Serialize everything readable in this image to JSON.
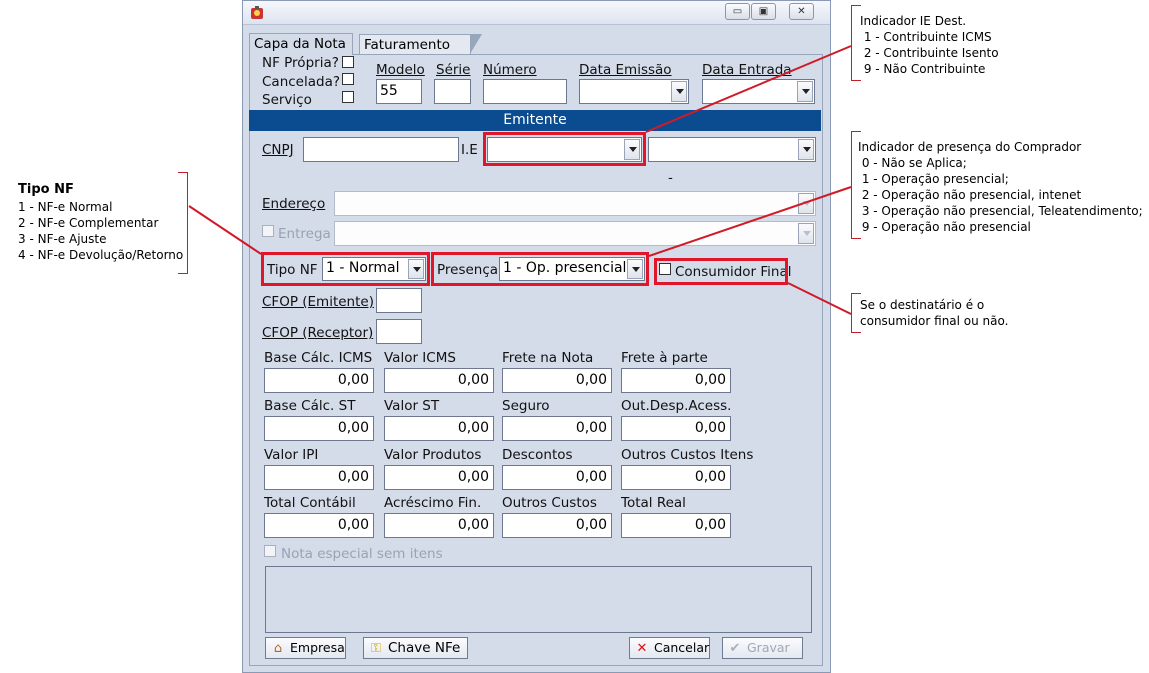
{
  "tabs": {
    "capa": "Capa da Nota",
    "faturamento": "Faturamento"
  },
  "window_controls": {
    "minimize": "▭",
    "restore": "▣",
    "close": "✕"
  },
  "flags": {
    "nf_propria": "NF Própria?",
    "cancelada": "Cancelada?",
    "servico": "Serviço"
  },
  "header_fields": {
    "modelo_label": "Modelo",
    "modelo_value": "55",
    "serie_label": "Série",
    "serie_value": "",
    "numero_label": "Número",
    "numero_value": "",
    "data_emissao_label": "Data Emissão",
    "data_emissao_value": "",
    "data_entrada_label": "Data Entrada",
    "data_entrada_value": ""
  },
  "emitente": {
    "section_title": "Emitente",
    "cnpj_label": "CNPJ",
    "cnpj_value": "",
    "ie_label": "I.E",
    "ie_value": "",
    "ie_extra_value": "",
    "dash": "-",
    "endereco_label": "Endereço",
    "endereco_value": "",
    "entrega_label": "Entrega",
    "entrega_value": ""
  },
  "selectors": {
    "tipo_nf_label": "Tipo NF",
    "tipo_nf_value": "1 - Normal",
    "presenca_label": "Presença",
    "presenca_value": "1 - Op. presencial;",
    "consumidor_final_label": "Consumidor Final"
  },
  "cfop": {
    "emitente_label": "CFOP (Emitente)",
    "receptor_label": "CFOP (Receptor)",
    "emitente_value": "",
    "receptor_value": ""
  },
  "totals": [
    {
      "label": "Base Cálc. ICMS",
      "value": "0,00"
    },
    {
      "label": "Valor ICMS",
      "value": "0,00"
    },
    {
      "label": "Frete na Nota",
      "value": "0,00"
    },
    {
      "label": "Frete à parte",
      "value": "0,00"
    },
    {
      "label": "Base Cálc. ST",
      "value": "0,00"
    },
    {
      "label": "Valor ST",
      "value": "0,00"
    },
    {
      "label": "Seguro",
      "value": "0,00"
    },
    {
      "label": "Out.Desp.Acess.",
      "value": "0,00"
    },
    {
      "label": "Valor IPI",
      "value": "0,00"
    },
    {
      "label": "Valor Produtos",
      "value": "0,00"
    },
    {
      "label": "Descontos",
      "value": "0,00"
    },
    {
      "label": "Outros Custos Itens",
      "value": "0,00"
    },
    {
      "label": "Total Contábil",
      "value": "0,00"
    },
    {
      "label": "Acréscimo Fin.",
      "value": "0,00"
    },
    {
      "label": "Outros Custos",
      "value": "0,00"
    },
    {
      "label": "Total Real",
      "value": "0,00"
    }
  ],
  "nota_especial_label": "Nota especial sem itens",
  "buttons": {
    "empresa": "Empresa",
    "chave_nfe": "Chave NFe",
    "cancelar": "Cancelar",
    "gravar": "Gravar"
  },
  "annotations": {
    "ie_dest": [
      "Indicador IE Dest.",
      " 1 - Contribuinte ICMS",
      " 2 - Contribuinte Isento",
      " 9 - Não Contribuinte"
    ],
    "presenca": [
      "Indicador de presença do Comprador",
      " 0 - Não se Aplica;",
      " 1 - Operação presencial;",
      " 2 - Operação não presencial, intenet",
      " 3 - Operação não presencial, Teleatendimento;",
      " 9 - Operação não presencial"
    ],
    "tipo_nf_title": "Tipo NF",
    "tipo_nf": [
      "1 - NF-e Normal",
      "2 - NF-e Complementar",
      "3 - NF-e Ajuste",
      "4 - NF-e Devolução/Retorno"
    ],
    "consumidor": [
      "Se o destinatário é o",
      "consumidor final ou não."
    ]
  },
  "colors": {
    "highlight": "#e0162b",
    "section_bar": "#0b4b8f",
    "window_bg": "#d4dcea"
  }
}
